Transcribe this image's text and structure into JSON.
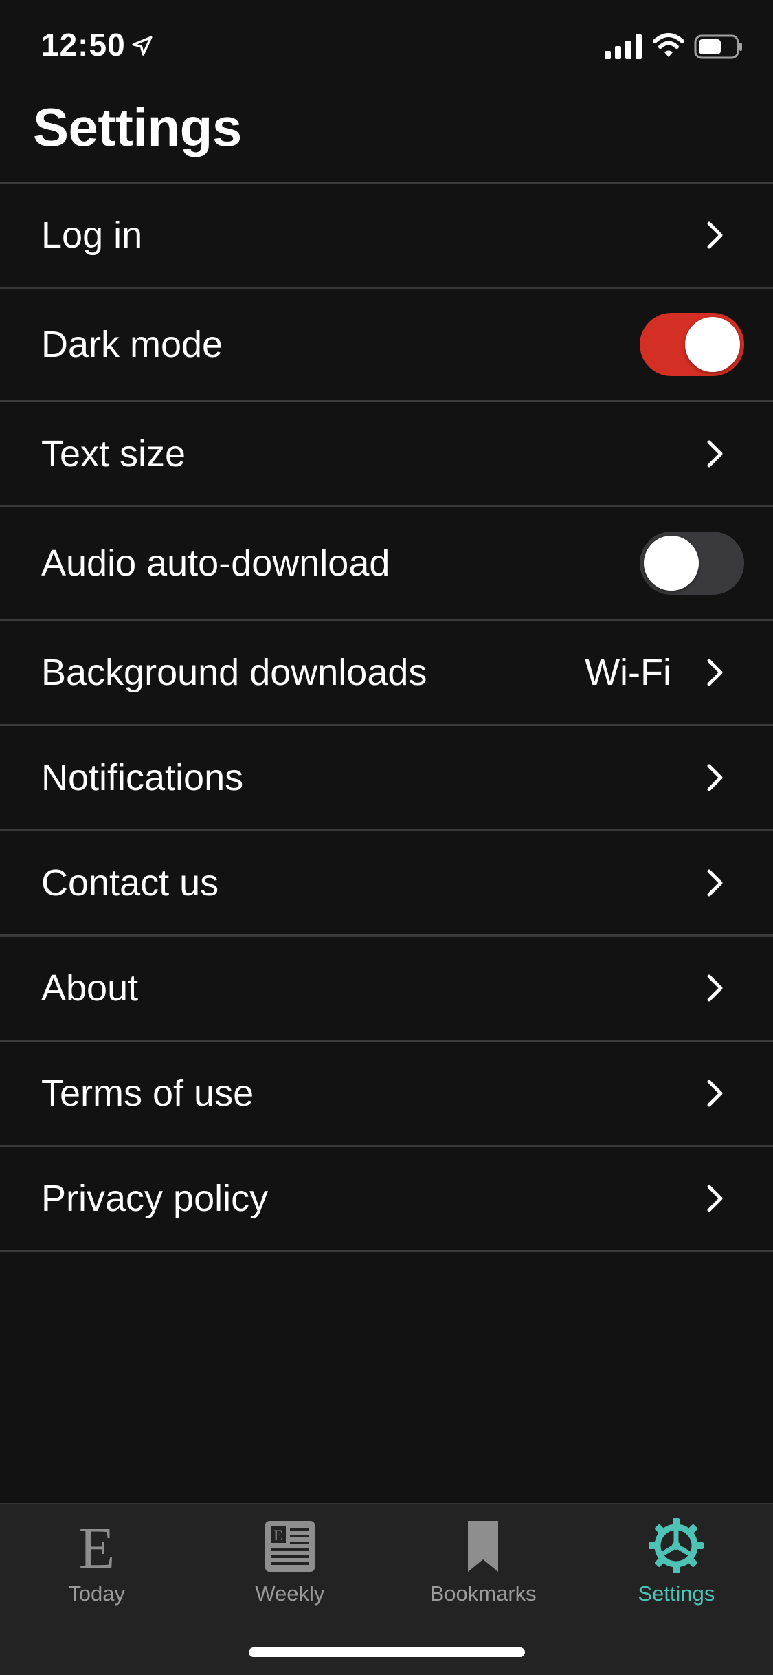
{
  "status_bar": {
    "time": "12:50"
  },
  "header": {
    "title": "Settings"
  },
  "settings": [
    {
      "label": "Log in",
      "control": "chevron"
    },
    {
      "label": "Dark mode",
      "control": "toggle",
      "on": true
    },
    {
      "label": "Text size",
      "control": "chevron"
    },
    {
      "label": "Audio auto-download",
      "control": "toggle",
      "on": false
    },
    {
      "label": "Background downloads",
      "value": "Wi-Fi",
      "control": "chevron"
    },
    {
      "label": "Notifications",
      "control": "chevron"
    },
    {
      "label": "Contact us",
      "control": "chevron"
    },
    {
      "label": "About",
      "control": "chevron"
    },
    {
      "label": "Terms of use",
      "control": "chevron"
    },
    {
      "label": "Privacy policy",
      "control": "chevron"
    }
  ],
  "tabs": [
    {
      "label": "Today",
      "icon": "economist-e-icon",
      "active": false
    },
    {
      "label": "Weekly",
      "icon": "newspaper-icon",
      "active": false
    },
    {
      "label": "Bookmarks",
      "icon": "bookmark-icon",
      "active": false
    },
    {
      "label": "Settings",
      "icon": "gear-icon",
      "active": true
    }
  ],
  "colors": {
    "background": "#121212",
    "toggle_on": "#d32f24",
    "toggle_off": "#3a3a3c",
    "tab_active": "#4fc2b6",
    "tab_inactive": "#9a9a9a"
  }
}
